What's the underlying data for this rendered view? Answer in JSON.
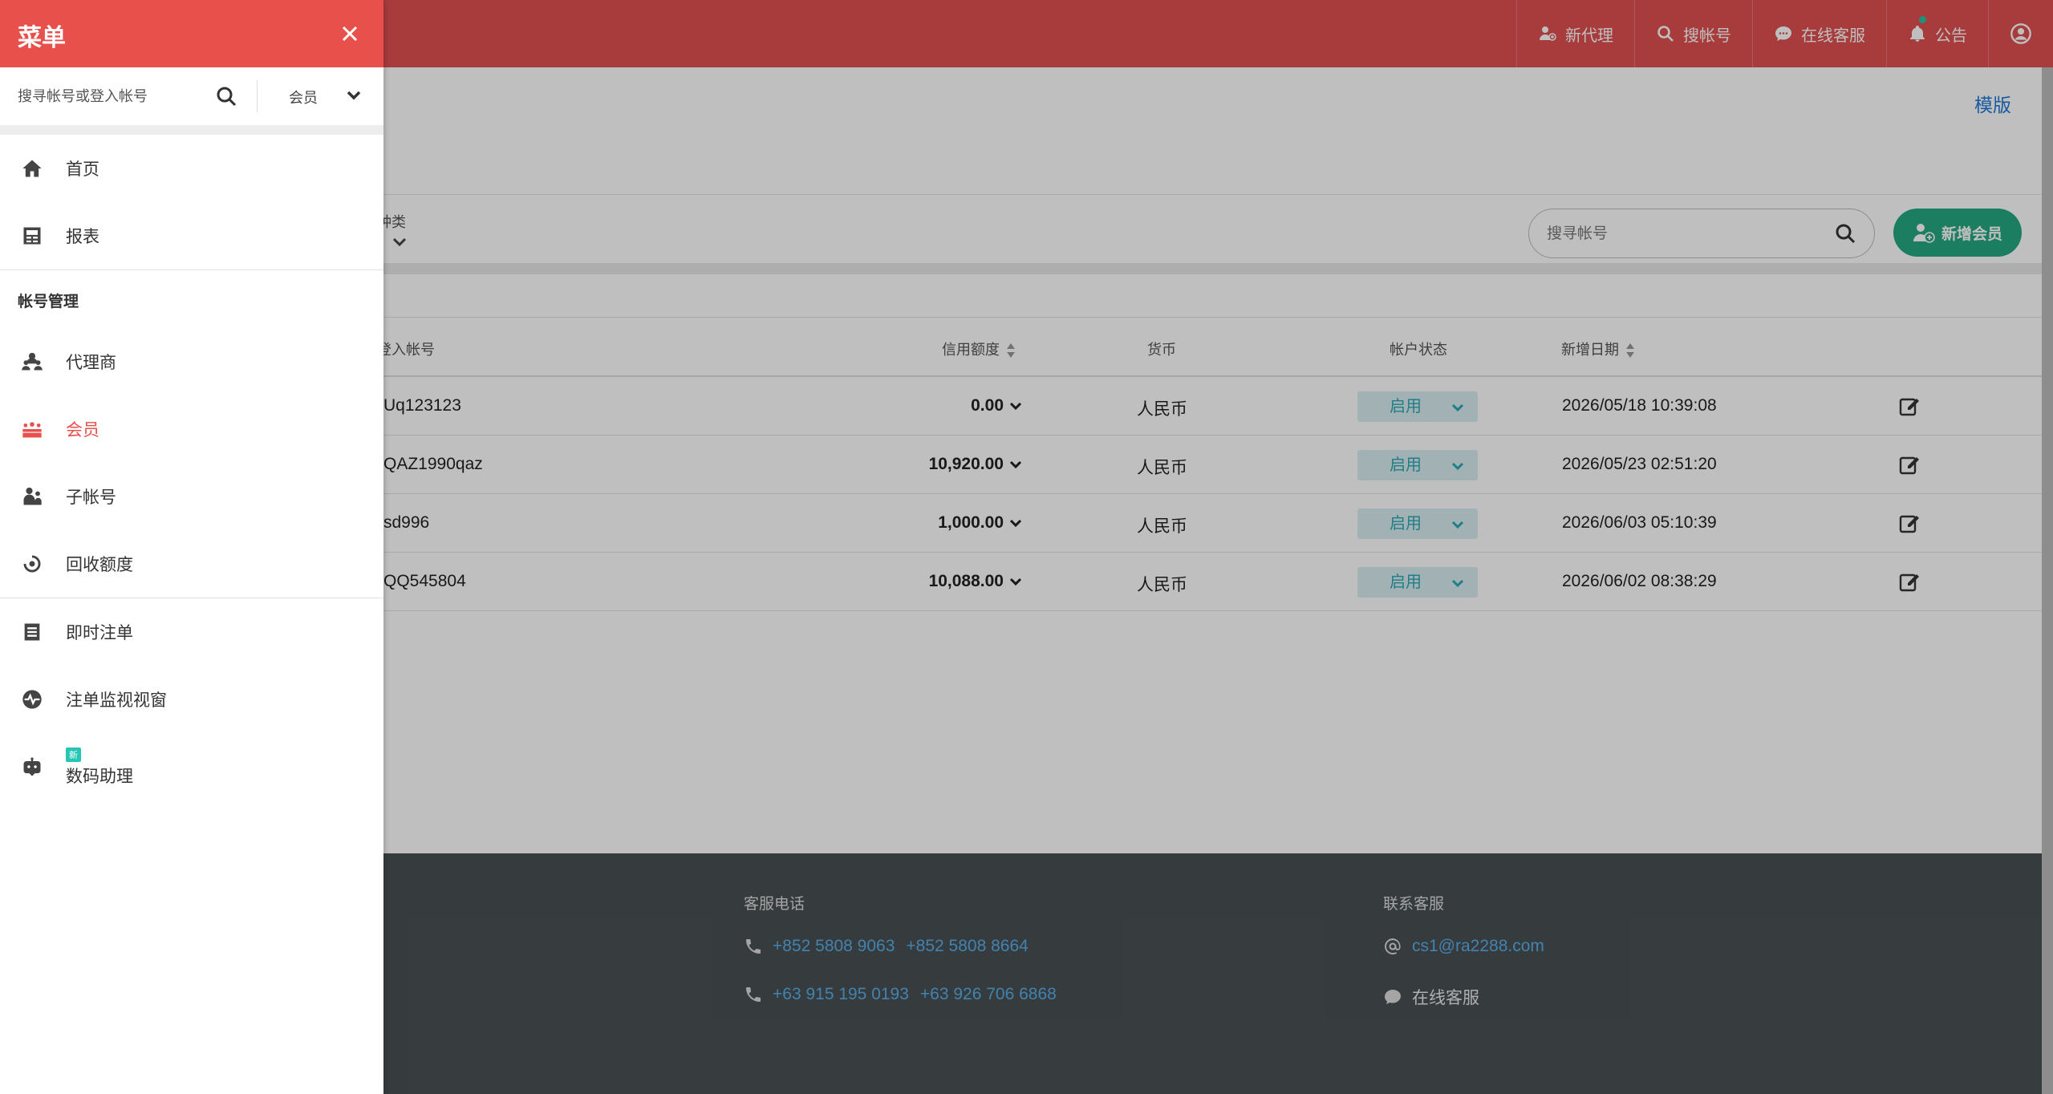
{
  "topbar": {
    "new_agent": "新代理",
    "search_account": "搜帐号",
    "online_service": "在线客服",
    "announcement": "公告"
  },
  "page": {
    "template_link": "模版",
    "filter_type_label": "种类",
    "search_placeholder": "搜寻帐号",
    "add_member_label": "新增会员"
  },
  "table": {
    "headers": {
      "login_account": "登入帐号",
      "credit": "信用额度",
      "currency": "货币",
      "status": "帐户状态",
      "created_date": "新增日期"
    },
    "rows": [
      {
        "account": "Uq123123",
        "credit": "0.00",
        "currency": "人民币",
        "status": "启用",
        "date": "2026/05/18 10:39:08"
      },
      {
        "account": "QAZ1990qaz",
        "credit": "10,920.00",
        "currency": "人民币",
        "status": "启用",
        "date": "2026/05/23 02:51:20"
      },
      {
        "account": "sd996",
        "credit": "1,000.00",
        "currency": "人民币",
        "status": "启用",
        "date": "2026/06/03 05:10:39"
      },
      {
        "account": "QQ545804",
        "credit": "10,088.00",
        "currency": "人民币",
        "status": "启用",
        "date": "2026/06/02 08:38:29"
      }
    ]
  },
  "footer": {
    "phone_title": "客服电话",
    "phone_1a": "+852 5808 9063",
    "phone_1b": "+852 5808 8664",
    "phone_2a": "+63 915 195 0193",
    "phone_2b": "+63 926 706 6868",
    "contact_title": "联系客服",
    "email": "cs1@ra2288.com",
    "online_service": "在线客服"
  },
  "menu": {
    "title": "菜单",
    "search_placeholder": "搜寻帐号或登入帐号",
    "role_select": "会员",
    "items": [
      {
        "label": "首页"
      },
      {
        "label": "报表"
      }
    ],
    "section_account": "帐号管理",
    "account_items": [
      {
        "label": "代理商"
      },
      {
        "label": "会员"
      },
      {
        "label": "子帐号"
      },
      {
        "label": "回收额度"
      }
    ],
    "other_items": [
      {
        "label": "即时注单"
      },
      {
        "label": "注单监视视窗"
      },
      {
        "label": "数码助理"
      }
    ],
    "new_badge": "新"
  },
  "colors": {
    "header_red": "#e8504c",
    "active_red": "#e8504c",
    "add_button_green": "#26a880",
    "status_teal": "#2aa8b6",
    "link_blue": "#1e78d6",
    "footer_bg": "#495053"
  }
}
